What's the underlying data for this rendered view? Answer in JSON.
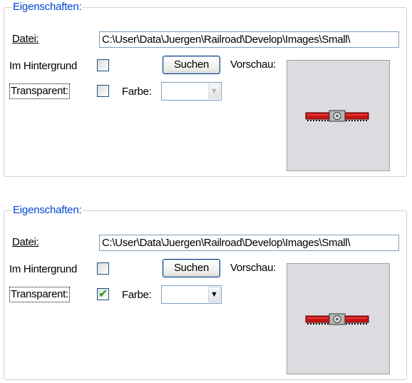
{
  "panels": [
    {
      "group_title": "Eigenschaften:",
      "datei_label": "Datei:",
      "datei_value": "C:\\User\\Data\\Juergen\\Railroad\\Develop\\Images\\Small\\",
      "hintergrund_label": "Im Hintergrund",
      "hintergrund_checked": false,
      "suchen_label": "Suchen",
      "vorschau_label": "Vorschau:",
      "transparent_label": "Transparent:",
      "transparent_checked": false,
      "farbe_label": "Farbe:",
      "farbe_enabled": false,
      "preview_image": "red-railcar-icon"
    },
    {
      "group_title": "Eigenschaften:",
      "datei_label": "Datei:",
      "datei_value": "C:\\User\\Data\\Juergen\\Railroad\\Develop\\Images\\Small\\",
      "hintergrund_label": "Im Hintergrund",
      "hintergrund_checked": false,
      "suchen_label": "Suchen",
      "vorschau_label": "Vorschau:",
      "transparent_label": "Transparent:",
      "transparent_checked": true,
      "farbe_label": "Farbe:",
      "farbe_enabled": true,
      "preview_image": "red-railcar-icon"
    }
  ],
  "colors": {
    "group_title": "#0046d5",
    "checkmark": "#21a121",
    "preview_bg": "#dcdce0",
    "railcar": "#c81414"
  }
}
